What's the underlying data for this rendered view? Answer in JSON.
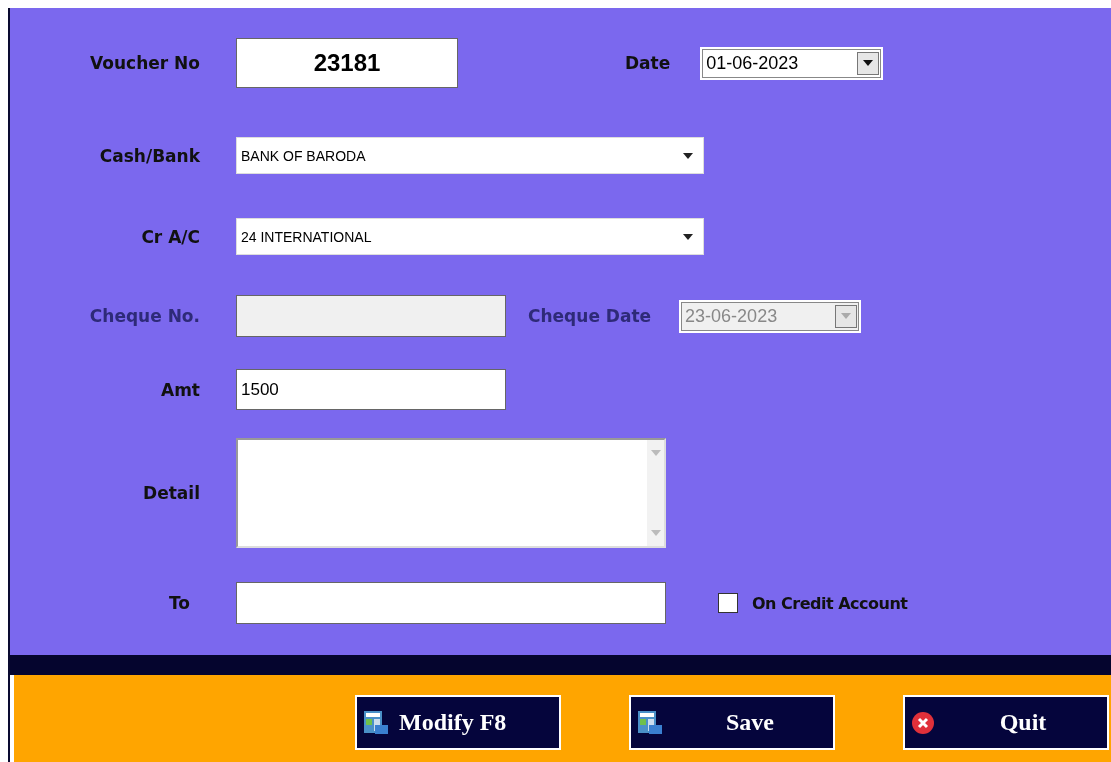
{
  "form": {
    "voucher_no": {
      "label": "Voucher No",
      "value": "23181"
    },
    "date": {
      "label": "Date",
      "value": "01-06-2023",
      "disabled": false
    },
    "cash_bank": {
      "label": "Cash/Bank",
      "value": "BANK OF BARODA"
    },
    "cr_ac": {
      "label": "Cr A/C",
      "value": "24 INTERNATIONAL"
    },
    "cheque_no": {
      "label": "Cheque No.",
      "disabled": true
    },
    "cheque_date": {
      "label": "Cheque Date",
      "value": "23-06-2023",
      "disabled": true
    },
    "amt": {
      "label": "Amt",
      "value": "1500"
    },
    "detail": {
      "label": "Detail"
    },
    "to": {
      "label": "To"
    },
    "on_credit_account": {
      "label": "On Credit Account",
      "checked": false
    }
  },
  "buttons": [
    {
      "label": "Modify F8",
      "kind": "modify"
    },
    {
      "label": "Save",
      "kind": "save"
    },
    {
      "label": "Quit",
      "kind": "quit"
    }
  ]
}
